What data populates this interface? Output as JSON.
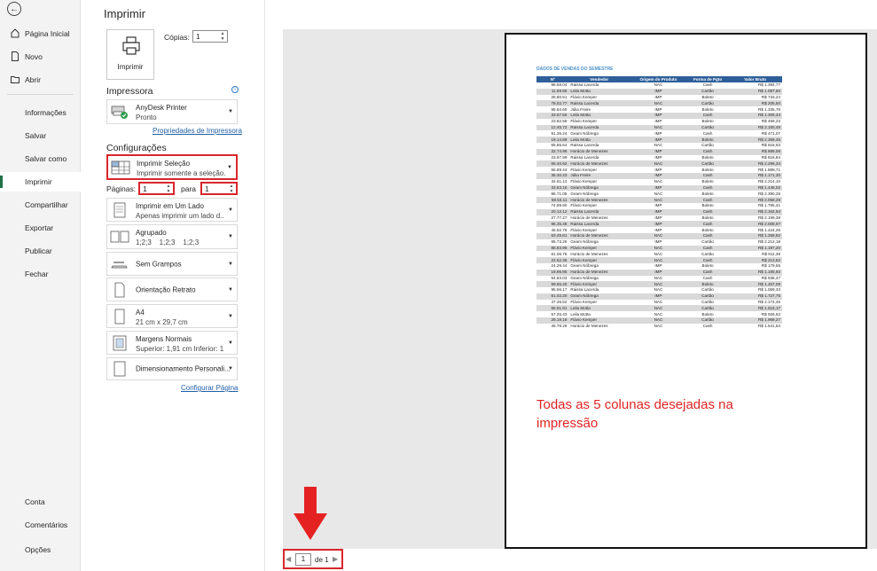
{
  "nav": {
    "back_icon": "back-arrow-icon",
    "items": [
      {
        "label": "Página Inicial",
        "icon": "home-icon"
      },
      {
        "label": "Novo",
        "icon": "new-file-icon"
      },
      {
        "label": "Abrir",
        "icon": "open-folder-icon"
      },
      {
        "label": "Informações"
      },
      {
        "label": "Salvar"
      },
      {
        "label": "Salvar como"
      },
      {
        "label": "Imprimir"
      },
      {
        "label": "Compartilhar"
      },
      {
        "label": "Exportar"
      },
      {
        "label": "Publicar"
      },
      {
        "label": "Fechar"
      },
      {
        "label": "Conta"
      },
      {
        "label": "Comentários"
      },
      {
        "label": "Opções"
      }
    ],
    "active_item": "Imprimir",
    "accent_color": "#1e7145"
  },
  "print": {
    "title": "Imprimir",
    "print_button": "Imprimir",
    "copies_label": "Cópias:",
    "copies_value": "1"
  },
  "printer": {
    "heading": "Impressora",
    "name": "AnyDesk Printer",
    "status": "Pronto",
    "properties_link": "Propriedades de Impressora"
  },
  "settings": {
    "heading": "Configurações",
    "print_what": {
      "line1": "Imprimir Seleção",
      "line2": "Imprimir somente a seleção..."
    },
    "pages_label": "Páginas:",
    "pages_from": "1",
    "pages_to_label": "para",
    "pages_to": "1",
    "sides": {
      "line1": "Imprimir em Um Lado",
      "line2": "Apenas imprimir um lado d..."
    },
    "collation": {
      "line1": "Agrupado",
      "line2": "1;2;3    1;2;3    1;2;3"
    },
    "staple": "Sem Grampos",
    "orientation": "Orientação Retrato",
    "paper": {
      "line1": "A4",
      "line2": "21 cm x 29,7 cm"
    },
    "margins": {
      "line1": "Margens Normais",
      "line2": "Superior: 1,91 cm Inferior: 1,..."
    },
    "scaling": "Dimensionamento Personali...",
    "page_setup_link": "Configurar Página",
    "highlight_color": "#d9262b"
  },
  "preview": {
    "sheet_title": "DADOS DE VENDAS DO SEMESTRE",
    "columns": [
      "Nº",
      "Vendedor",
      "Origem do Produto",
      "Forma de Pgto",
      "Valor Bruto"
    ],
    "rows": [
      [
        "98.58.04",
        "Raissa Lacerda",
        "NAC",
        "Cash",
        "R$ 1.384,77"
      ],
      [
        "11.59.65",
        "Leila Motta",
        "IMP",
        "Cartão",
        "R$ 1.097,50"
      ],
      [
        "26.80.51",
        "Flávio Kemper",
        "IMP",
        "Boleto",
        "R$ 733,24"
      ],
      [
        "78.02.77",
        "Raissa Lacerda",
        "NAC",
        "Cartão",
        "R$ 205,50"
      ],
      [
        "95.84.60",
        "Júlia Freire",
        "IMP",
        "Boleto",
        "R$ 1.335,76"
      ],
      [
        "33.67.56",
        "Leila Motta",
        "IMP",
        "Cash",
        "R$ 1.309,34"
      ],
      [
        "23.82.58",
        "Flávio Kemper",
        "IMP",
        "Boleto",
        "R$ 459,23"
      ],
      [
        "12.45.72",
        "Raissa Lacerda",
        "NAC",
        "Cartão",
        "R$ 2.160,49"
      ],
      [
        "91.35.24",
        "Geam Nóbrega",
        "IMP",
        "Cash",
        "R$ 471,07"
      ],
      [
        "19.14.89",
        "Leila Motta",
        "IMP",
        "Boleto",
        "R$ 2.369,45"
      ],
      [
        "65.65.64",
        "Raissa Lacerda",
        "NAC",
        "Cartão",
        "R$ 615,63"
      ],
      [
        "32.74.98",
        "Horácio de Menezes",
        "IMP",
        "Cash",
        "R$ 889,06"
      ],
      [
        "23.67.99",
        "Raissa Lacerda",
        "IMP",
        "Boleto",
        "R$ 816,84"
      ],
      [
        "65.40.62",
        "Horácio de Menezes",
        "NAC",
        "Cartão",
        "R$ 2.296,34"
      ],
      [
        "55.89.44",
        "Flávio Kemper",
        "IMP",
        "Boleto",
        "R$ 1.889,71"
      ],
      [
        "35.30.23",
        "Júlia Freire",
        "IMP",
        "Cash",
        "R$ 1.171,30"
      ],
      [
        "32.61.13",
        "Flávio Kemper",
        "NAC",
        "Boleto",
        "R$ 2.214,10"
      ],
      [
        "33.63.15",
        "Geam Nóbrega",
        "IMP",
        "Cash",
        "R$ 1.445,02"
      ],
      [
        "86.71.05",
        "Geam Nóbrega",
        "NAC",
        "Boleto",
        "R$ 2.390,25"
      ],
      [
        "59.53.11",
        "Horácio de Menezes",
        "NAC",
        "Cash",
        "R$ 2.058,29"
      ],
      [
        "74.99.90",
        "Flávio Kemper",
        "IMP",
        "Boleto",
        "R$ 1.795,41"
      ],
      [
        "20.12.12",
        "Raissa Lacerda",
        "IMP",
        "Cash",
        "R$ 2.162,94"
      ],
      [
        "27.77.27",
        "Horácio de Menezes",
        "IMP",
        "Boleto",
        "R$ 2.199,39"
      ],
      [
        "96.35.48",
        "Raissa Lacerda",
        "IMP",
        "Cash",
        "R$ 2.008,97"
      ],
      [
        "45.92.75",
        "Flávio Kemper",
        "IMP",
        "Boleto",
        "R$ 1.424,26"
      ],
      [
        "63.45.81",
        "Horácio de Menezes",
        "NAC",
        "Cash",
        "R$ 1.258,82"
      ],
      [
        "95.73.26",
        "Geam Nóbrega",
        "IMP",
        "Cartão",
        "R$ 2.212,18"
      ],
      [
        "88.83.96",
        "Flávio Kemper",
        "NAC",
        "Cash",
        "R$ 1.197,20"
      ],
      [
        "81.06.76",
        "Horácio de Menezes",
        "NAC",
        "Cartão",
        "R$ 911,39"
      ],
      [
        "22.52.35",
        "Flávio Kemper",
        "NAC",
        "Cash",
        "R$ 213,82"
      ],
      [
        "24.29.44",
        "Geam Nóbrega",
        "IMP",
        "Boleto",
        "R$ 179,55"
      ],
      [
        "19.96.95",
        "Horácio de Menezes",
        "IMP",
        "Cash",
        "R$ 1.185,92"
      ],
      [
        "54.83.03",
        "Geam Nóbrega",
        "NAC",
        "Cash",
        "R$ 936,47"
      ],
      [
        "99.65.25",
        "Flávio Kemper",
        "NAC",
        "Boleto",
        "R$ 1.467,09"
      ],
      [
        "95.56.17",
        "Raissa Lacerda",
        "NAC",
        "Cartão",
        "R$ 1.059,33"
      ],
      [
        "81.02.20",
        "Geam Nóbrega",
        "IMP",
        "Cartão",
        "R$ 1.727,75"
      ],
      [
        "47.26.52",
        "Flávio Kemper",
        "NAC",
        "Cartão",
        "R$ 2.174,45"
      ],
      [
        "65.91.91",
        "Leila Motta",
        "NAC",
        "Cartão",
        "R$ 1.618,17"
      ],
      [
        "57.26.43",
        "Leila Motta",
        "NAC",
        "Boleto",
        "R$ 926,62"
      ],
      [
        "29.19.18",
        "Flávio Kemper",
        "NAC",
        "Cartão",
        "R$ 1.969,27"
      ],
      [
        "45.78.29",
        "Horácio de Menezes",
        "NAC",
        "Cash",
        "R$ 1.541,54"
      ]
    ],
    "annotation": "Todas as 5 colunas desejadas na impressão",
    "annotation_color": "#e02323",
    "header_color": "#2e5f9a"
  },
  "page_nav": {
    "current": "1",
    "of_label": "de 1",
    "prev_icon": "prev-page-icon",
    "next_icon": "next-page-icon"
  }
}
